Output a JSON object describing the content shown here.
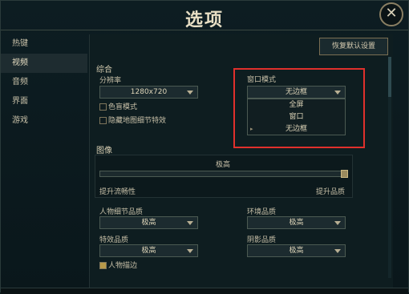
{
  "window": {
    "title": "选项",
    "close_label": "✕"
  },
  "sidebar": {
    "items": [
      {
        "label": "热键"
      },
      {
        "label": "视频"
      },
      {
        "label": "音频"
      },
      {
        "label": "界面"
      },
      {
        "label": "游戏"
      }
    ]
  },
  "toolbar": {
    "restore_defaults_label": "恢复默认设置"
  },
  "general": {
    "title": "综合",
    "resolution_label": "分辨率",
    "resolution_value": "1280x720",
    "colorblind_label": "色盲模式",
    "hide_eye_candy_label": "隐藏地图细节特效",
    "window_mode_label": "窗口模式",
    "window_mode_value": "无边框",
    "window_mode_options": [
      "全屏",
      "窗口",
      "无边框"
    ]
  },
  "graphics": {
    "title": "图像",
    "quality_value": "极高",
    "quality_level": 1.0,
    "left_label": "提升流畅性",
    "right_label": "提升品质"
  },
  "quality_settings": {
    "character_label": "人物细节品质",
    "character_value": "极高",
    "environment_label": "环境品质",
    "environment_value": "极高",
    "effects_label": "特效品质",
    "effects_value": "极高",
    "shadow_label": "阴影品质",
    "shadow_value": "极高",
    "character_inking_label": "人物描边"
  },
  "colors": {
    "highlight": "#e0302c",
    "accent": "#b89a4a"
  }
}
